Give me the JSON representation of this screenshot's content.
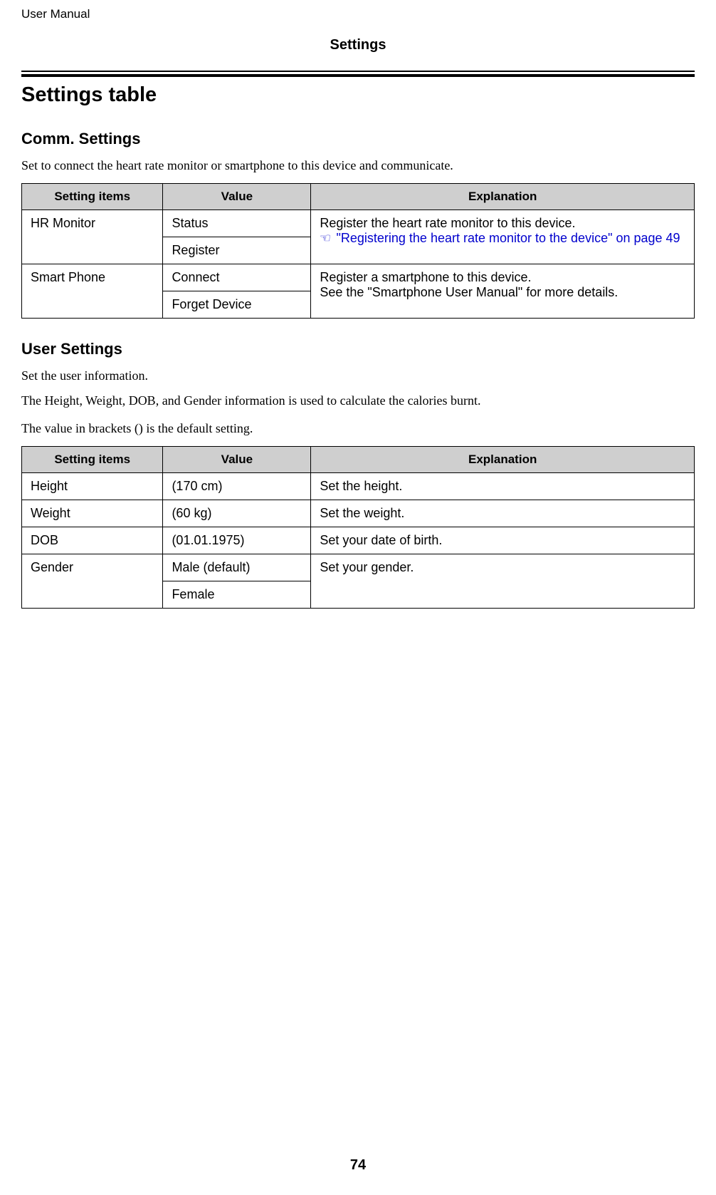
{
  "running_header": "User Manual",
  "chapter_title": "Settings",
  "section_title": "Settings table",
  "comm": {
    "heading": "Comm. Settings",
    "intro": "Set to connect the heart rate monitor or smartphone to this device and communicate.",
    "headers": {
      "items": "Setting items",
      "value": "Value",
      "explanation": "Explanation"
    },
    "rows": {
      "hr_monitor": {
        "item": "HR Monitor",
        "values": [
          "Status",
          "Register"
        ],
        "explanation_line1": "Register the heart rate monitor to this device.",
        "xref": "\"Registering the heart rate monitor to the device\" on page 49"
      },
      "smart_phone": {
        "item": "Smart Phone",
        "values": [
          "Connect",
          "Forget Device"
        ],
        "explanation_line1": "Register a smartphone to this device.",
        "explanation_line2": "See the \"Smartphone User Manual\" for more details."
      }
    }
  },
  "user": {
    "heading": "User Settings",
    "intro1": "Set the user information.",
    "intro2": "The Height, Weight, DOB, and Gender information is used to calculate the calories burnt.",
    "intro3": "The value in brackets () is the default setting.",
    "headers": {
      "items": "Setting items",
      "value": "Value",
      "explanation": "Explanation"
    },
    "rows": {
      "height": {
        "item": "Height",
        "value": "(170 cm)",
        "explanation": "Set the height."
      },
      "weight": {
        "item": "Weight",
        "value": "(60 kg)",
        "explanation": "Set the weight."
      },
      "dob": {
        "item": "DOB",
        "value": "(01.01.1975)",
        "explanation": "Set your date of birth."
      },
      "gender": {
        "item": "Gender",
        "values": [
          "Male (default)",
          "Female"
        ],
        "explanation": "Set your gender."
      }
    }
  },
  "page_number": "74"
}
